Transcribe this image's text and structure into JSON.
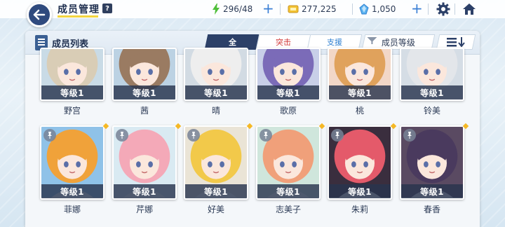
{
  "header": {
    "title": "成员管理",
    "help_label": "?",
    "ap": "296/48",
    "credits": "277,225",
    "pyroxene": "1,050",
    "plus_label": "+"
  },
  "panel": {
    "title": "成员列表",
    "tabs": [
      {
        "label": "全",
        "active": true
      },
      {
        "label": "突击",
        "active": false
      },
      {
        "label": "支援",
        "active": false
      }
    ],
    "sort_label": "成员等级"
  },
  "colors": {
    "accent_navy": "#2c4068",
    "striker_red": "#d23a3a",
    "special_blue": "#2f7fd0",
    "star_gold": "#f5b825"
  },
  "row1": [
    {
      "name": "野宫",
      "level": "等级1",
      "hair": "#d9cdb6",
      "bg": "#c9dbe6"
    },
    {
      "name": "茜",
      "level": "等级1",
      "hair": "#9a7b62",
      "bg": "#bcd2e3"
    },
    {
      "name": "晴",
      "level": "等级1",
      "hair": "#eeeeee",
      "bg": "#d2dbe3"
    },
    {
      "name": "歌原",
      "level": "等级1",
      "hair": "#7b6bb8",
      "bg": "#c8cfe8"
    },
    {
      "name": "桃",
      "level": "等级1",
      "hair": "#e0a25c",
      "bg": "#f2d7c7"
    },
    {
      "name": "铃美",
      "level": "等级1",
      "hair": "#e3e6ea",
      "bg": "#d5dde5"
    }
  ],
  "row2": [
    {
      "name": "菲娜",
      "level": "等级1",
      "hair": "#f0a23a",
      "bg": "#8fc2e8"
    },
    {
      "name": "芹娜",
      "level": "等级1",
      "hair": "#f4a9b8",
      "bg": "#d9eaf2"
    },
    {
      "name": "好美",
      "level": "等级1",
      "hair": "#f2c94a",
      "bg": "#eae4d6"
    },
    {
      "name": "志美子",
      "level": "等级1",
      "hair": "#f0a07a",
      "bg": "#cfe6dc"
    },
    {
      "name": "朱莉",
      "level": "等级1",
      "hair": "#e45a6a",
      "bg": "#3a2e3e"
    },
    {
      "name": "春香",
      "level": "等级1",
      "hair": "#4a3a5e",
      "bg": "#5a4a62"
    }
  ]
}
